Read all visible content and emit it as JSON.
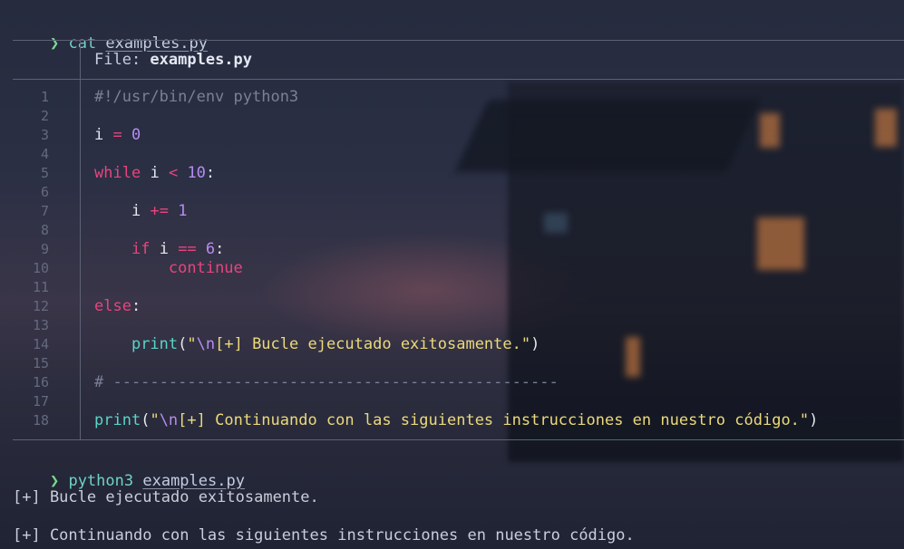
{
  "prompt_symbol": "❯",
  "commands": [
    {
      "cmd": "cat",
      "arg": "examples.py"
    },
    {
      "cmd": "python3",
      "arg": "examples.py"
    }
  ],
  "file_header": {
    "label": "File: ",
    "name": "examples.py"
  },
  "code_lines": [
    {
      "n": "1",
      "tokens": [
        {
          "t": "#!/usr/bin/env python3",
          "c": "comment"
        }
      ]
    },
    {
      "n": "2",
      "tokens": []
    },
    {
      "n": "3",
      "tokens": [
        {
          "t": "i",
          "c": "ident"
        },
        {
          "t": " "
        },
        {
          "t": "=",
          "c": "op"
        },
        {
          "t": " "
        },
        {
          "t": "0",
          "c": "num"
        }
      ]
    },
    {
      "n": "4",
      "tokens": []
    },
    {
      "n": "5",
      "tokens": [
        {
          "t": "while",
          "c": "kw"
        },
        {
          "t": " "
        },
        {
          "t": "i",
          "c": "ident"
        },
        {
          "t": " "
        },
        {
          "t": "<",
          "c": "op"
        },
        {
          "t": " "
        },
        {
          "t": "10",
          "c": "num"
        },
        {
          "t": ":",
          "c": "punc"
        }
      ]
    },
    {
      "n": "6",
      "tokens": []
    },
    {
      "n": "7",
      "tokens": [
        {
          "t": "    "
        },
        {
          "t": "i",
          "c": "ident"
        },
        {
          "t": " "
        },
        {
          "t": "+=",
          "c": "op"
        },
        {
          "t": " "
        },
        {
          "t": "1",
          "c": "num"
        }
      ]
    },
    {
      "n": "8",
      "tokens": []
    },
    {
      "n": "9",
      "tokens": [
        {
          "t": "    "
        },
        {
          "t": "if",
          "c": "kw"
        },
        {
          "t": " "
        },
        {
          "t": "i",
          "c": "ident"
        },
        {
          "t": " "
        },
        {
          "t": "==",
          "c": "op"
        },
        {
          "t": " "
        },
        {
          "t": "6",
          "c": "num"
        },
        {
          "t": ":",
          "c": "punc"
        }
      ]
    },
    {
      "n": "10",
      "tokens": [
        {
          "t": "        "
        },
        {
          "t": "continue",
          "c": "kw"
        }
      ]
    },
    {
      "n": "11",
      "tokens": []
    },
    {
      "n": "12",
      "tokens": [
        {
          "t": "else",
          "c": "kw"
        },
        {
          "t": ":",
          "c": "punc"
        }
      ]
    },
    {
      "n": "13",
      "tokens": []
    },
    {
      "n": "14",
      "tokens": [
        {
          "t": "    "
        },
        {
          "t": "print",
          "c": "fn"
        },
        {
          "t": "(",
          "c": "punc"
        },
        {
          "t": "\"",
          "c": "str"
        },
        {
          "t": "\\n",
          "c": "esc"
        },
        {
          "t": "[+] Bucle ejecutado exitosamente.\"",
          "c": "str"
        },
        {
          "t": ")",
          "c": "punc"
        }
      ]
    },
    {
      "n": "15",
      "tokens": []
    },
    {
      "n": "16",
      "tokens": [
        {
          "t": "# ------------------------------------------------",
          "c": "comment"
        }
      ]
    },
    {
      "n": "17",
      "tokens": []
    },
    {
      "n": "18",
      "tokens": [
        {
          "t": "print",
          "c": "fn"
        },
        {
          "t": "(",
          "c": "punc"
        },
        {
          "t": "\"",
          "c": "str"
        },
        {
          "t": "\\n",
          "c": "esc"
        },
        {
          "t": "[+] Continuando con las siguientes instrucciones en nuestro código.\"",
          "c": "str"
        },
        {
          "t": ")",
          "c": "punc"
        }
      ]
    }
  ],
  "output_lines": [
    "[+] Bucle ejecutado exitosamente.",
    "[+] Continuando con las siguientes instrucciones en nuestro código."
  ]
}
